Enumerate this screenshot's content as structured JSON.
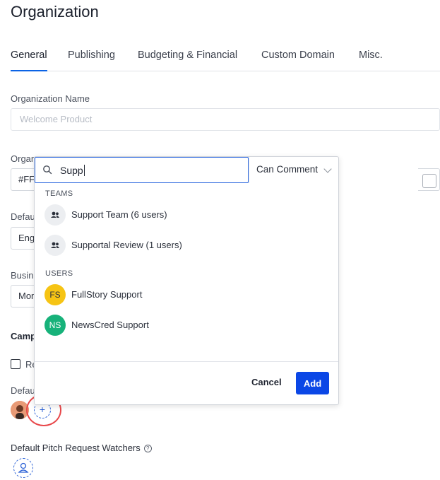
{
  "page": {
    "title": "Organization"
  },
  "tabs": [
    {
      "label": "General",
      "active": true
    },
    {
      "label": "Publishing"
    },
    {
      "label": "Budgeting & Financial"
    },
    {
      "label": "Custom Domain"
    },
    {
      "label": "Misc."
    }
  ],
  "form": {
    "org_name_label": "Organization Name",
    "org_name_placeholder": "Welcome Product",
    "org_color_label": "Organization Color",
    "org_color_value": "#FF",
    "default_label": "Defau",
    "default_value": "Eng",
    "business_label": "Busin",
    "business_value": "Mon",
    "campaign_label": "Camp",
    "checkbox_label": "Re",
    "default_watchers_label": "Defau",
    "pitch_watchers_label": "Default Pitch Request Watchers",
    "help_icon": "?"
  },
  "popover": {
    "search_value": "Supp",
    "permission": "Can Comment",
    "teams_heading": "TEAMS",
    "teams": [
      {
        "label": "Support Team (6 users)"
      },
      {
        "label": "Supportal Review (1 users)"
      }
    ],
    "users_heading": "USERS",
    "users": [
      {
        "initials": "FS",
        "label": "FullStory Support",
        "color": "#f6c414"
      },
      {
        "initials": "NS",
        "label": "NewsCred Support",
        "color": "#17b27a"
      }
    ],
    "cancel_label": "Cancel",
    "add_label": "Add"
  },
  "colors": {
    "accent": "#0b47e6",
    "focus": "#2f6ae0",
    "highlight": "#e8474a"
  }
}
